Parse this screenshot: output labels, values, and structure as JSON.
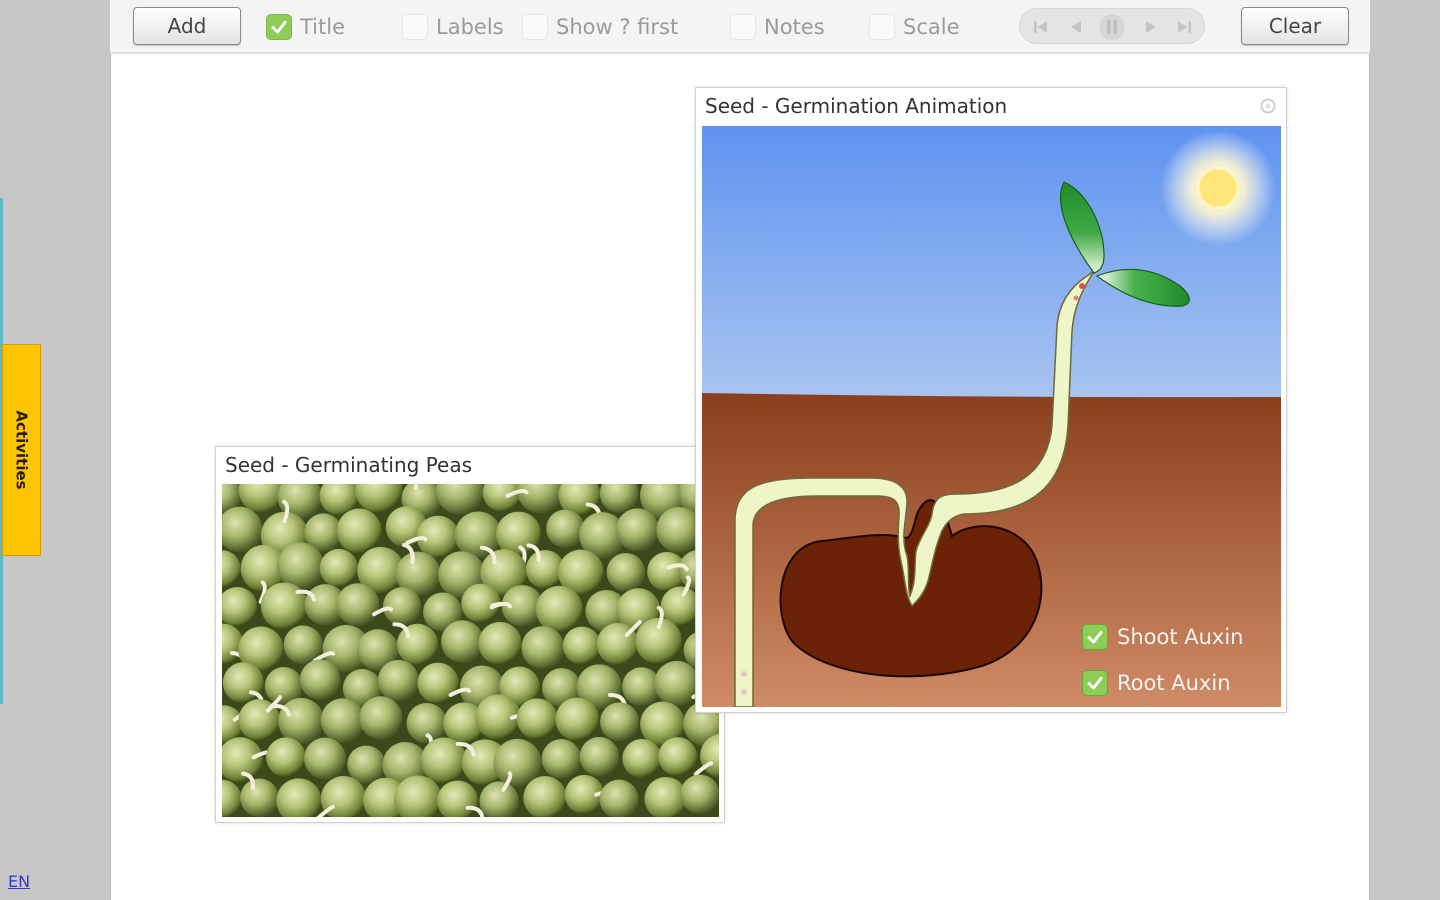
{
  "toolbar": {
    "add_label": "Add",
    "clear_label": "Clear",
    "options": [
      {
        "label": "Title",
        "checked": true
      },
      {
        "label": "Labels",
        "checked": false
      },
      {
        "label": "Show ? first",
        "checked": false
      },
      {
        "label": "Notes",
        "checked": false
      },
      {
        "label": "Scale",
        "checked": false
      }
    ],
    "player": [
      "first-icon",
      "back-icon",
      "pause-icon",
      "forward-icon",
      "last-icon"
    ]
  },
  "sidebar": {
    "activities_label": "Activities",
    "language_label": "EN"
  },
  "panels": {
    "peas": {
      "title": "Seed - Germinating Peas"
    },
    "animation": {
      "title": "Seed - Germination Animation",
      "toggles": [
        {
          "label": "Shoot Auxin",
          "checked": true
        },
        {
          "label": "Root Auxin",
          "checked": true
        }
      ]
    }
  },
  "colors": {
    "check_green": "#8ccc57",
    "activities_tab": "#ffc400",
    "sky_top": "#5f93f0",
    "soil": "#8a3e1e",
    "seed": "#6b2206"
  }
}
